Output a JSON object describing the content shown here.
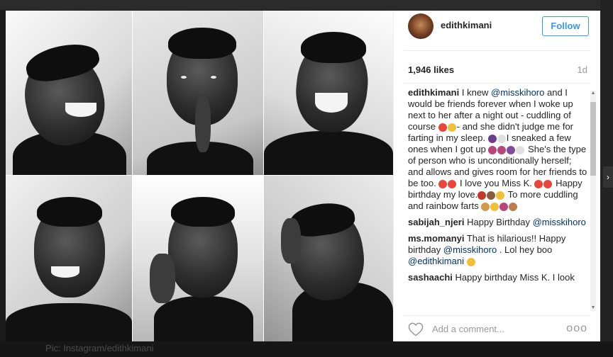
{
  "post": {
    "username": "edithkimani",
    "follow_label": "Follow",
    "likes": "1,946 likes",
    "time_ago": "1d",
    "caption": {
      "username": "edithkimani",
      "segments": [
        {
          "t": "text",
          "v": " I knew "
        },
        {
          "t": "mention",
          "v": "@misskihoro"
        },
        {
          "t": "text",
          "v": " and I would be friends forever when I woke up next to her after a night out - cuddling of course "
        },
        {
          "t": "emoji",
          "v": [
            "#e8463a",
            "#f0c03b"
          ]
        },
        {
          "t": "text",
          "v": "- and she didn't judge me for farting in my sleep. "
        },
        {
          "t": "emoji",
          "v": [
            "#6b3f8c",
            "#e0e0e0"
          ]
        },
        {
          "t": "text",
          "v": "I sneaked a few ones when I got up "
        },
        {
          "t": "emoji",
          "v": [
            "#b6467c",
            "#b6467c",
            "#7e4c9c",
            "#e0e0e0"
          ]
        },
        {
          "t": "text",
          "v": " She's the type of person who is unconditionally herself; and allows and gives room for her friends to be too. "
        },
        {
          "t": "emoji",
          "v": [
            "#e8463a",
            "#e8463a"
          ]
        },
        {
          "t": "text",
          "v": " I love you Miss K. "
        },
        {
          "t": "emoji",
          "v": [
            "#e8463a",
            "#e8463a"
          ]
        },
        {
          "t": "text",
          "v": " Happy birthday my love."
        },
        {
          "t": "emoji",
          "v": [
            "#c0392b",
            "#8a5a3c",
            "#f0c03b"
          ]
        },
        {
          "t": "text",
          "v": " To more cuddling and rainbow farts "
        },
        {
          "t": "emoji",
          "v": [
            "#d19a4f",
            "#f0c03b",
            "#b6467c",
            "#c07a4e"
          ]
        }
      ]
    },
    "comments": [
      {
        "username": "sabijah_njeri",
        "text": " Happy Birthday ",
        "mention": "@misskihoro",
        "after": ""
      },
      {
        "username": "ms.momanyi",
        "text": " That is hilarious!! Happy birthday ",
        "mention": "@misskihoro",
        "after": " . Lol hey boo ",
        "mention2": "@edithkimani",
        "emoji": [
          "#f0c03b"
        ]
      },
      {
        "username": "sashaachi",
        "text": " Happy birthday Miss K. I look",
        "mention": "",
        "after": ""
      }
    ],
    "comment_placeholder": "Add a comment...",
    "more_label": "ooo"
  },
  "backdrop": {
    "bottom_text": "Pic: Instagram/edithkimani"
  },
  "colors": {
    "accent": "#3897f0",
    "mention": "#003569",
    "text": "#262626",
    "muted": "#999999"
  }
}
